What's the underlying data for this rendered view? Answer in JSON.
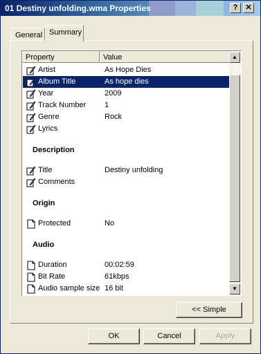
{
  "window": {
    "title": "01 Destiny unfolding.wma Properties",
    "help_glyph": "?",
    "close_glyph": "✕"
  },
  "tabs": [
    {
      "label": "General",
      "active": false
    },
    {
      "label": "Summary",
      "active": true
    }
  ],
  "list": {
    "columns": [
      "Property",
      "Value"
    ],
    "rows": {
      "artist": {
        "name": "Artist",
        "value": "As Hope Dies",
        "icon": "edit-icon"
      },
      "album": {
        "name": "Album Title",
        "value": "As hope dies",
        "icon": "edit-icon",
        "selected": true
      },
      "year": {
        "name": "Year",
        "value": "2009",
        "icon": "edit-icon"
      },
      "track": {
        "name": "Track Number",
        "value": "1",
        "icon": "edit-icon"
      },
      "genre": {
        "name": "Genre",
        "value": "Rock",
        "icon": "edit-icon"
      },
      "lyrics": {
        "name": "Lyrics",
        "value": "",
        "icon": "edit-icon"
      },
      "title": {
        "name": "Title",
        "value": "Destiny unfolding",
        "icon": "edit-icon"
      },
      "comments": {
        "name": "Comments",
        "value": "",
        "icon": "edit-icon"
      },
      "protected": {
        "name": "Protected",
        "value": "No",
        "icon": "document-icon"
      },
      "duration": {
        "name": "Duration",
        "value": "00:02:59",
        "icon": "document-icon"
      },
      "bitrate": {
        "name": "Bit Rate",
        "value": "61kbps",
        "icon": "document-icon"
      },
      "samplesize": {
        "name": "Audio sample size",
        "value": "16 bit",
        "icon": "document-icon"
      }
    },
    "sections": {
      "description": "Description",
      "origin": "Origin",
      "audio": "Audio"
    }
  },
  "buttons": {
    "simple": "<< Simple",
    "ok": "OK",
    "cancel": "Cancel",
    "apply": "Apply"
  },
  "colors": {
    "selection": "#0a246a",
    "face": "#ece9d8"
  }
}
